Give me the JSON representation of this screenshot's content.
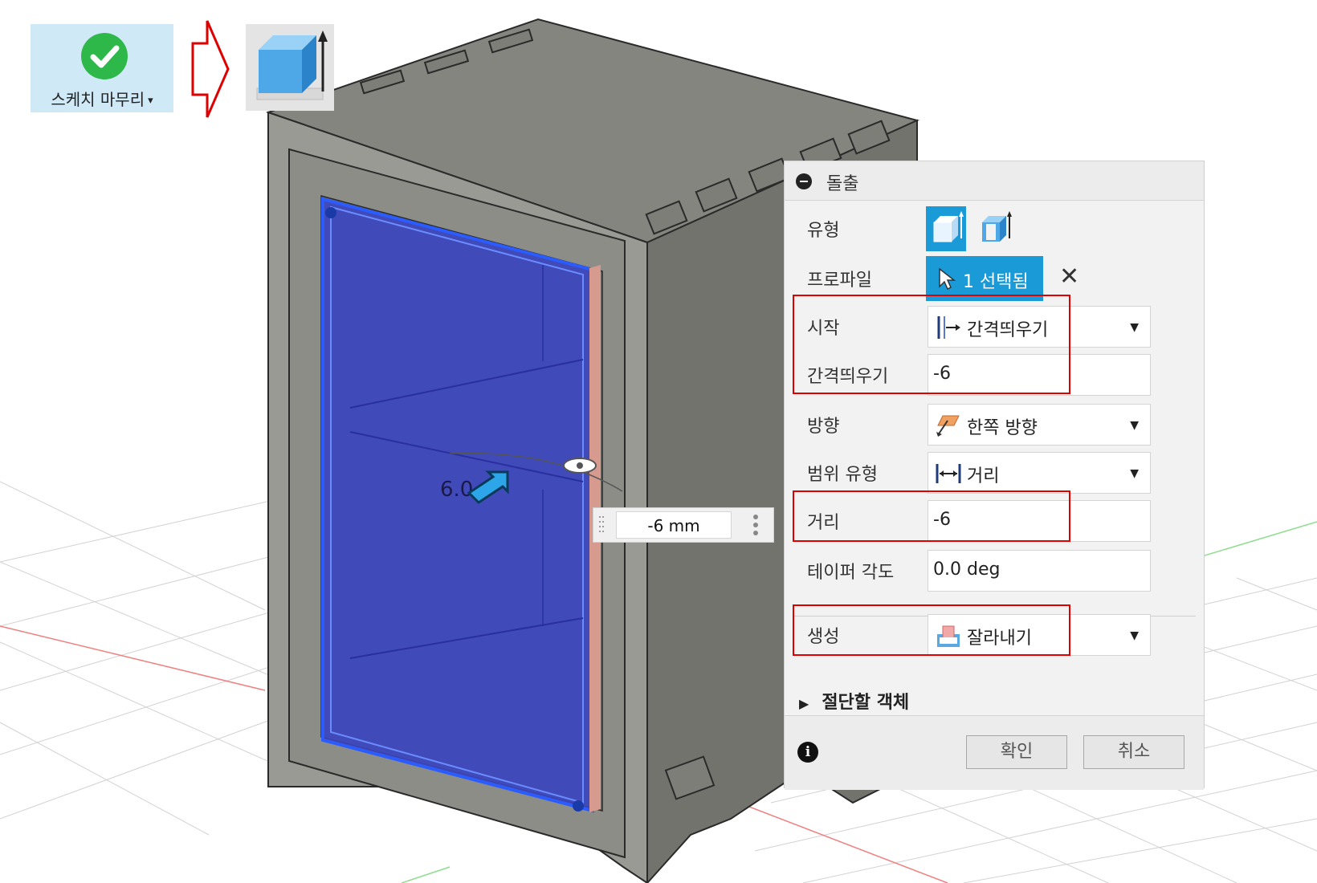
{
  "toolbar": {
    "finish_sketch_label": "스케치 마무리",
    "finish_sketch_caret": "▾"
  },
  "viewport": {
    "dimension_value": "-6 mm",
    "canvas_dim_label": "6.0"
  },
  "panel": {
    "title": "돌출",
    "rows": {
      "type_label": "유형",
      "profile_label": "프로파일",
      "profile_value": "1 선택됨",
      "start_label": "시작",
      "start_value": "간격띄우기",
      "offset_label": "간격띄우기",
      "offset_value": "-6",
      "direction_label": "방향",
      "direction_value": "한쪽 방향",
      "extent_label": "범위 유형",
      "extent_value": "거리",
      "distance_label": "거리",
      "distance_value": "-6",
      "taper_label": "테이퍼 각도",
      "taper_value": "0.0 deg",
      "operation_label": "생성",
      "operation_value": "잘라내기"
    },
    "objects_to_cut_label": "절단할 객체",
    "ok_label": "확인",
    "cancel_label": "취소",
    "clear_symbol": "✕",
    "info_symbol": "i"
  },
  "colors": {
    "accent": "#1a9ad7",
    "highlight": "#e00000",
    "selection_face": "#4a52c8",
    "body_gray": "#8a8a85"
  }
}
